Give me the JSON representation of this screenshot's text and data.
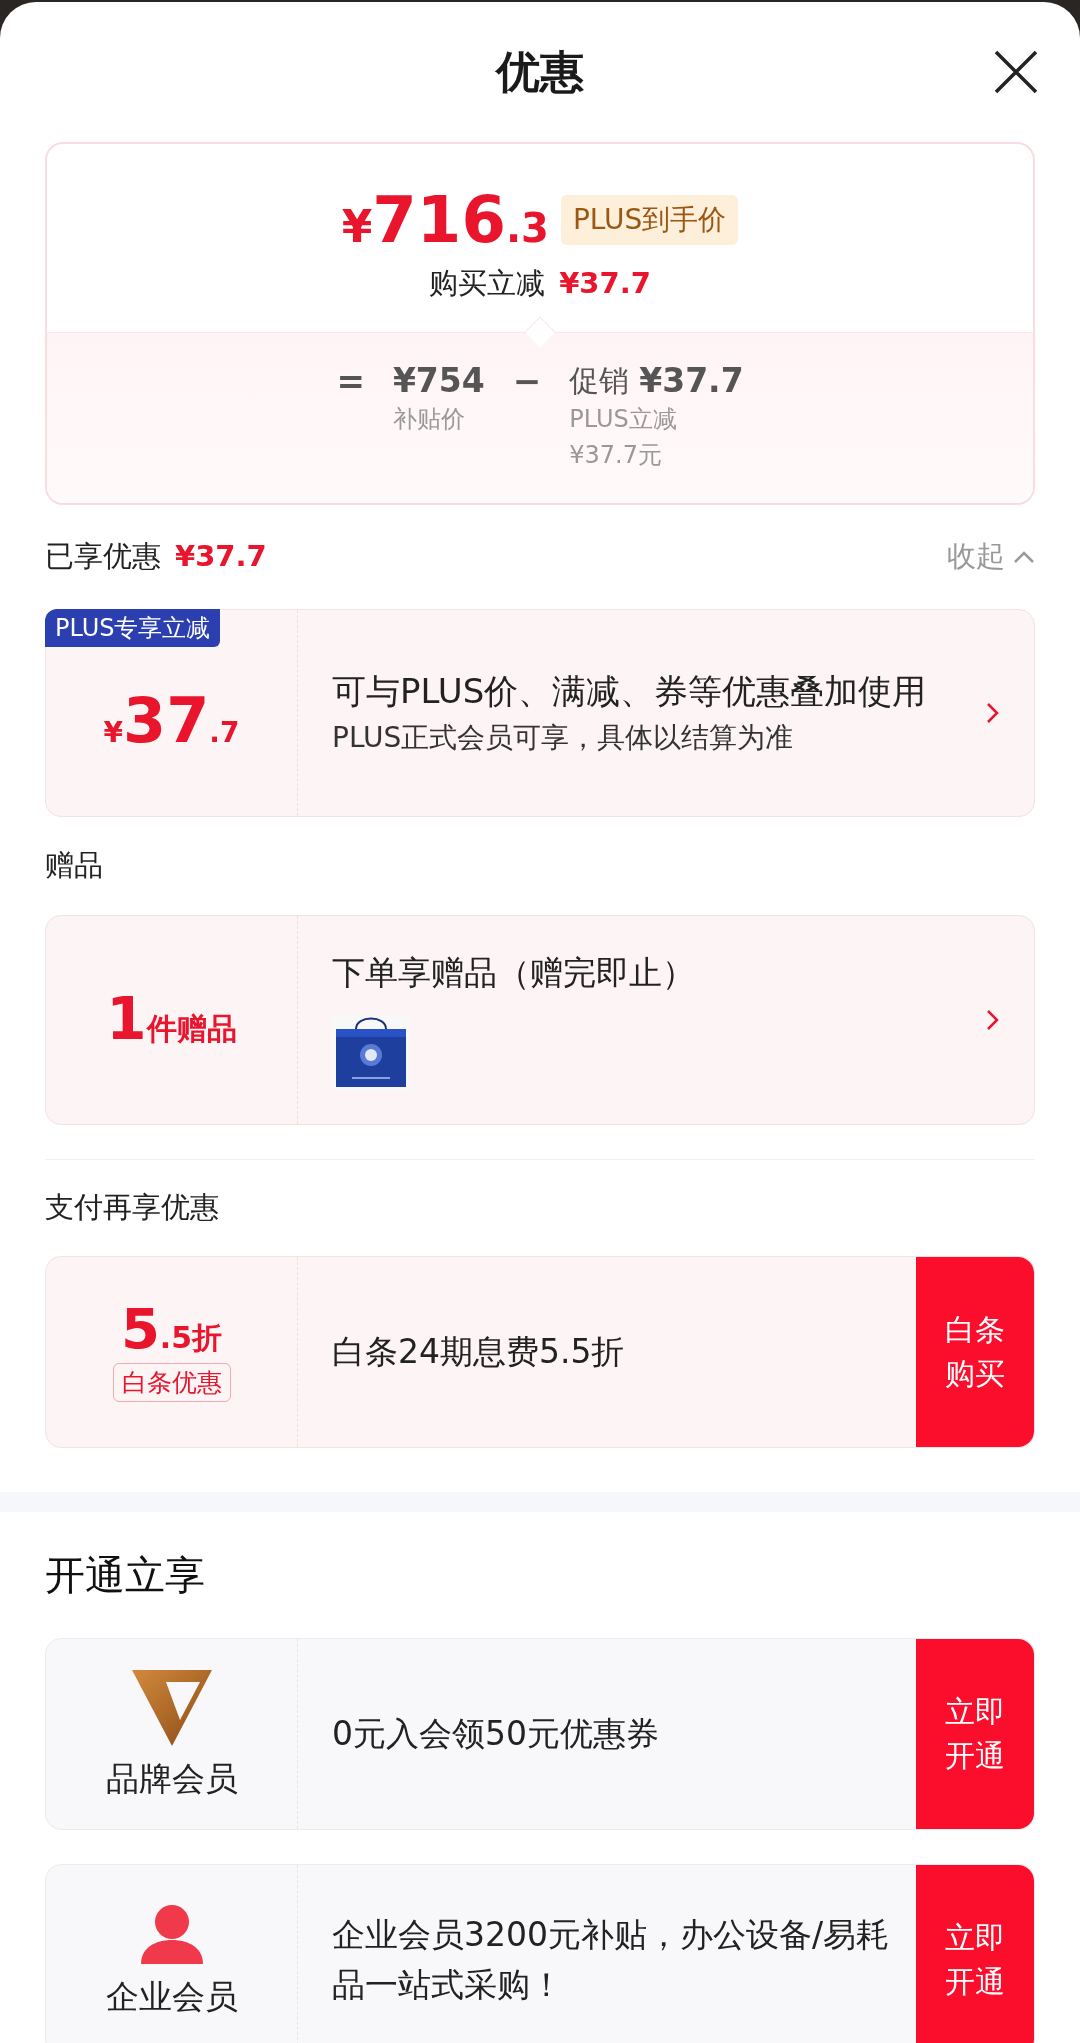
{
  "header": {
    "title": "优惠"
  },
  "summary": {
    "symbol": "¥",
    "price_integer": "716",
    "price_decimal": ".3",
    "price_tag": "PLUS到手价",
    "instant_label": "购买立减",
    "instant_amount": "¥37.7",
    "equals": "=",
    "base_price": "¥754",
    "base_label": "补贴价",
    "minus": "−",
    "promo_label": "促销",
    "promo_amount": "¥37.7",
    "promo_details": [
      "PLUS立减",
      "¥37.7元"
    ]
  },
  "enjoyed": {
    "label": "已享优惠",
    "amount": "¥37.7",
    "toggle": "收起"
  },
  "plus_card": {
    "badge": "PLUS专享立减",
    "symbol": "¥",
    "integer": "37",
    "decimal": ".7",
    "title": "可与PLUS价、满减、券等优惠叠加使用",
    "subtitle": "PLUS正式会员可享，具体以结算为准"
  },
  "gift_section": {
    "heading": "赠品",
    "count": "1",
    "unit": "件赠品",
    "title": "下单享赠品（赠完即止）"
  },
  "payment_section": {
    "heading": "支付再享优惠",
    "integer": "5",
    "decimal": ".5",
    "unit": "折",
    "tag": "白条优惠",
    "title": "白条24期息费5.5折",
    "button": "白条购买"
  },
  "membership_section": {
    "heading": "开通立享",
    "items": [
      {
        "kind": "brand",
        "label": "品牌会员",
        "title": "0元入会领50元优惠券",
        "button": "立即开通"
      },
      {
        "kind": "enterprise",
        "label": "企业会员",
        "title": "企业会员3200元补贴，办公设备/易耗品一站式采购！",
        "button": "立即开通"
      }
    ]
  }
}
